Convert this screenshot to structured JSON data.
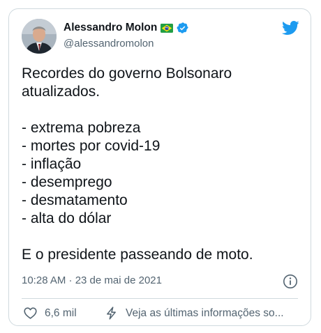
{
  "author": {
    "display_name": "Alessandro Molon",
    "handle": "@alessandromolon",
    "flag_icon": "brazil-flag-icon",
    "verified_icon": "verified-badge-icon"
  },
  "tweet": {
    "lines": [
      "Recordes do governo Bolsonaro",
      "atualizados.",
      "",
      "- extrema pobreza",
      "- mortes por covid-19",
      "- inflação",
      "- desemprego",
      "- desmatamento",
      "- alta do dólar",
      "",
      "E o presidente passeando de moto."
    ],
    "timestamp": "10:28 AM · 23 de mai de 2021"
  },
  "actions": {
    "likes": "6,6 mil",
    "news_label": "Veja as últimas informações so..."
  },
  "colors": {
    "twitter_blue": "#1d9bf0",
    "text_primary": "#0f1419",
    "text_secondary": "#536471",
    "border": "#cfd9de"
  },
  "icons": {
    "logo": "twitter-bird-icon",
    "info": "info-icon",
    "like": "heart-icon",
    "news": "lightning-bolt-icon"
  }
}
